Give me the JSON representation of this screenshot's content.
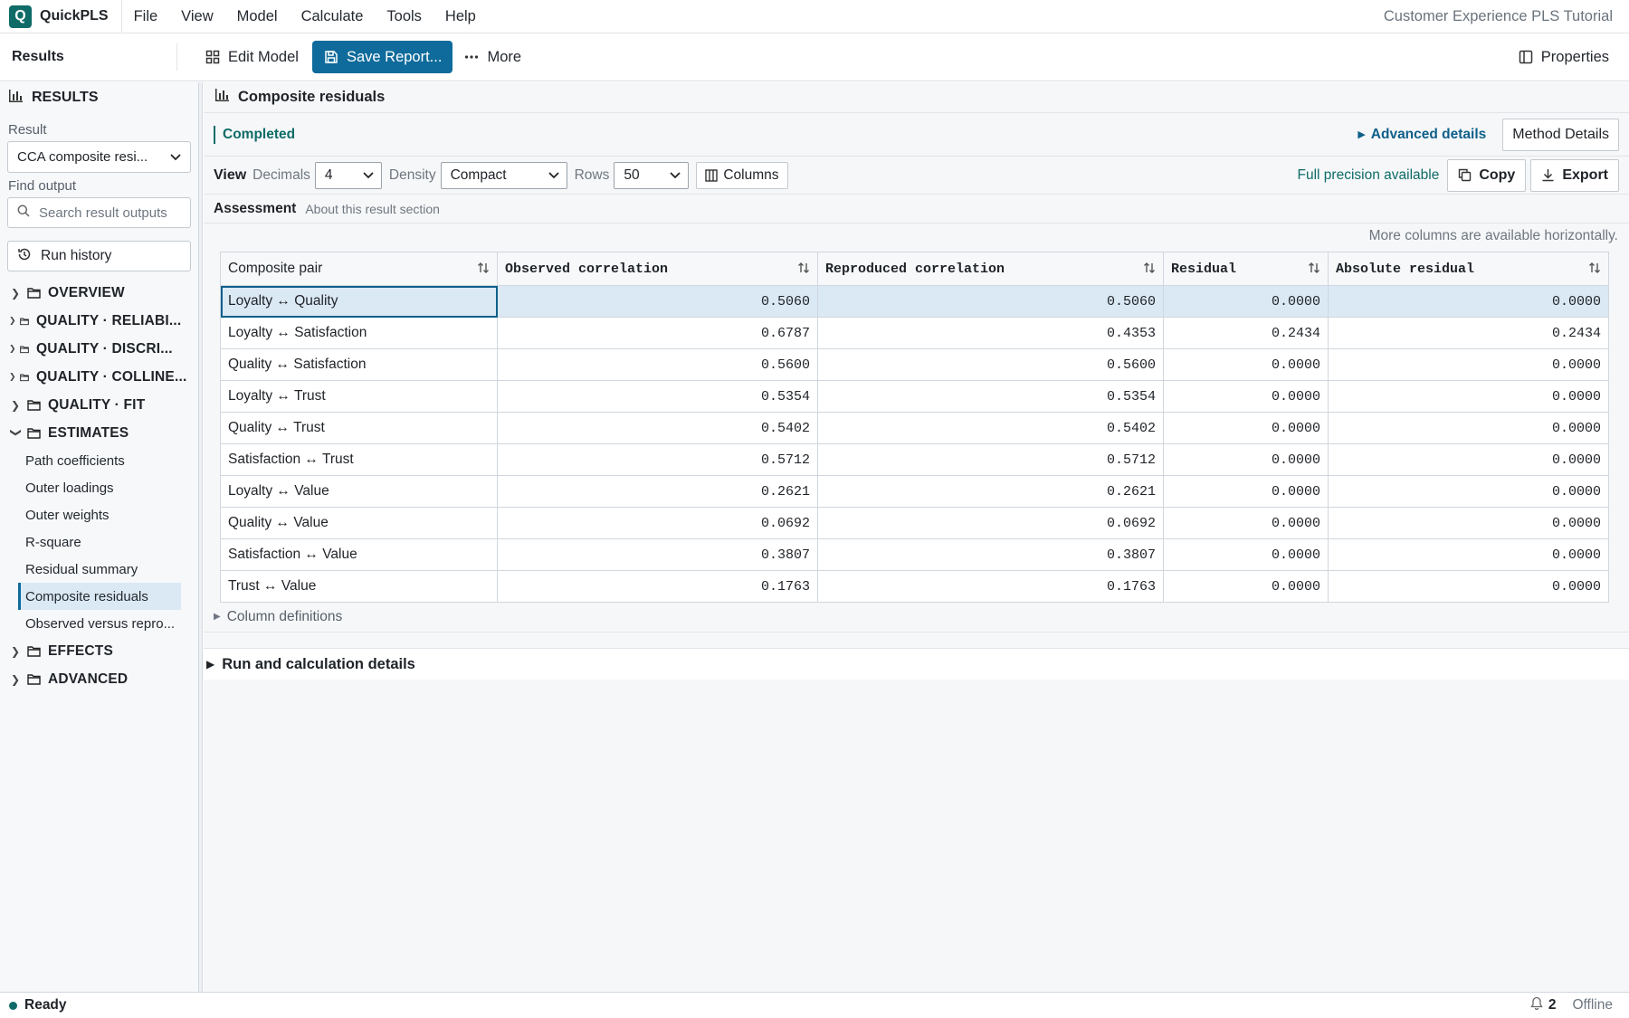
{
  "app": {
    "name": "QuickPLS",
    "logo_letter": "Q",
    "project_title": "Customer Experience PLS Tutorial",
    "accent_color": "#0e6b68",
    "primary_color": "#0e6b9b"
  },
  "menu": [
    "File",
    "View",
    "Model",
    "Calculate",
    "Tools",
    "Help"
  ],
  "toolbar": {
    "section": "Results",
    "edit_model": "Edit Model",
    "save_report": "Save Report...",
    "more": "More",
    "properties": "Properties"
  },
  "sidebar": {
    "title": "RESULTS",
    "result_label": "Result",
    "result_value": "CCA composite resi...",
    "find_label": "Find output",
    "search_placeholder": "Search result outputs",
    "run_history": "Run history",
    "groups": [
      {
        "label": "OVERVIEW",
        "expanded": false
      },
      {
        "label": "QUALITY · RELIABI...",
        "expanded": false
      },
      {
        "label": "QUALITY · DISCRI...",
        "expanded": false
      },
      {
        "label": "QUALITY · COLLINE...",
        "expanded": false
      },
      {
        "label": "QUALITY · FIT",
        "expanded": false
      },
      {
        "label": "ESTIMATES",
        "expanded": true
      },
      {
        "label": "EFFECTS",
        "expanded": false
      },
      {
        "label": "ADVANCED",
        "expanded": false
      }
    ],
    "estimates_items": [
      "Path coefficients",
      "Outer loadings",
      "Outer weights",
      "R-square",
      "Residual summary",
      "Composite residuals",
      "Observed versus repro..."
    ],
    "active_item": "Composite residuals"
  },
  "main": {
    "title": "Composite residuals",
    "status": "Completed",
    "advanced_details": "Advanced details",
    "method_details": "Method Details",
    "view_label": "View",
    "decimals_label": "Decimals",
    "decimals_value": "4",
    "density_label": "Density",
    "density_value": "Compact",
    "rows_label": "Rows",
    "rows_value": "50",
    "columns_button": "Columns",
    "precision_note": "Full precision available",
    "copy": "Copy",
    "export": "Export",
    "assessment_title": "Assessment",
    "assessment_sub": "About this result section",
    "more_columns_note": "More columns are available horizontally.",
    "column_definitions": "Column definitions",
    "run_details": "Run and calculation details"
  },
  "table": {
    "headers": [
      "Composite pair",
      "Observed correlation",
      "Reproduced correlation",
      "Residual",
      "Absolute residual"
    ],
    "rows": [
      [
        "Loyalty ↔ Quality",
        "0.5060",
        "0.5060",
        "0.0000",
        "0.0000"
      ],
      [
        "Loyalty ↔ Satisfaction",
        "0.6787",
        "0.4353",
        "0.2434",
        "0.2434"
      ],
      [
        "Quality ↔ Satisfaction",
        "0.5600",
        "0.5600",
        "0.0000",
        "0.0000"
      ],
      [
        "Loyalty ↔ Trust",
        "0.5354",
        "0.5354",
        "0.0000",
        "0.0000"
      ],
      [
        "Quality ↔ Trust",
        "0.5402",
        "0.5402",
        "0.0000",
        "0.0000"
      ],
      [
        "Satisfaction ↔ Trust",
        "0.5712",
        "0.5712",
        "0.0000",
        "0.0000"
      ],
      [
        "Loyalty ↔ Value",
        "0.2621",
        "0.2621",
        "0.0000",
        "0.0000"
      ],
      [
        "Quality ↔ Value",
        "0.0692",
        "0.0692",
        "0.0000",
        "0.0000"
      ],
      [
        "Satisfaction ↔ Value",
        "0.3807",
        "0.3807",
        "0.0000",
        "0.0000"
      ],
      [
        "Trust ↔ Value",
        "0.1763",
        "0.1763",
        "0.0000",
        "0.0000"
      ]
    ]
  },
  "statusbar": {
    "status": "Ready",
    "notifications": "2",
    "connection": "Offline"
  }
}
